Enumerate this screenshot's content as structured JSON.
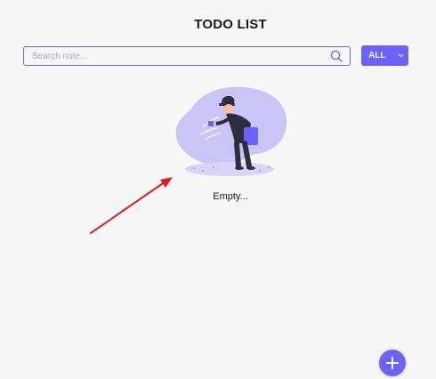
{
  "header": {
    "title": "TODO LIST"
  },
  "search": {
    "placeholder": "Search note...",
    "value": "",
    "icon": "search-icon"
  },
  "filter": {
    "selected": "ALL",
    "icon": "chevron-down-icon"
  },
  "empty_state": {
    "illustration": "person-looking-empty-illustration",
    "text": "Empty..."
  },
  "add_button": {
    "icon": "plus-icon"
  },
  "annotation": {
    "icon": "red-arrow-icon"
  },
  "colors": {
    "accent": "#6c63ff",
    "background": "#f7f7f7",
    "annotation": "#e02020",
    "text": "#1a1a1a"
  }
}
